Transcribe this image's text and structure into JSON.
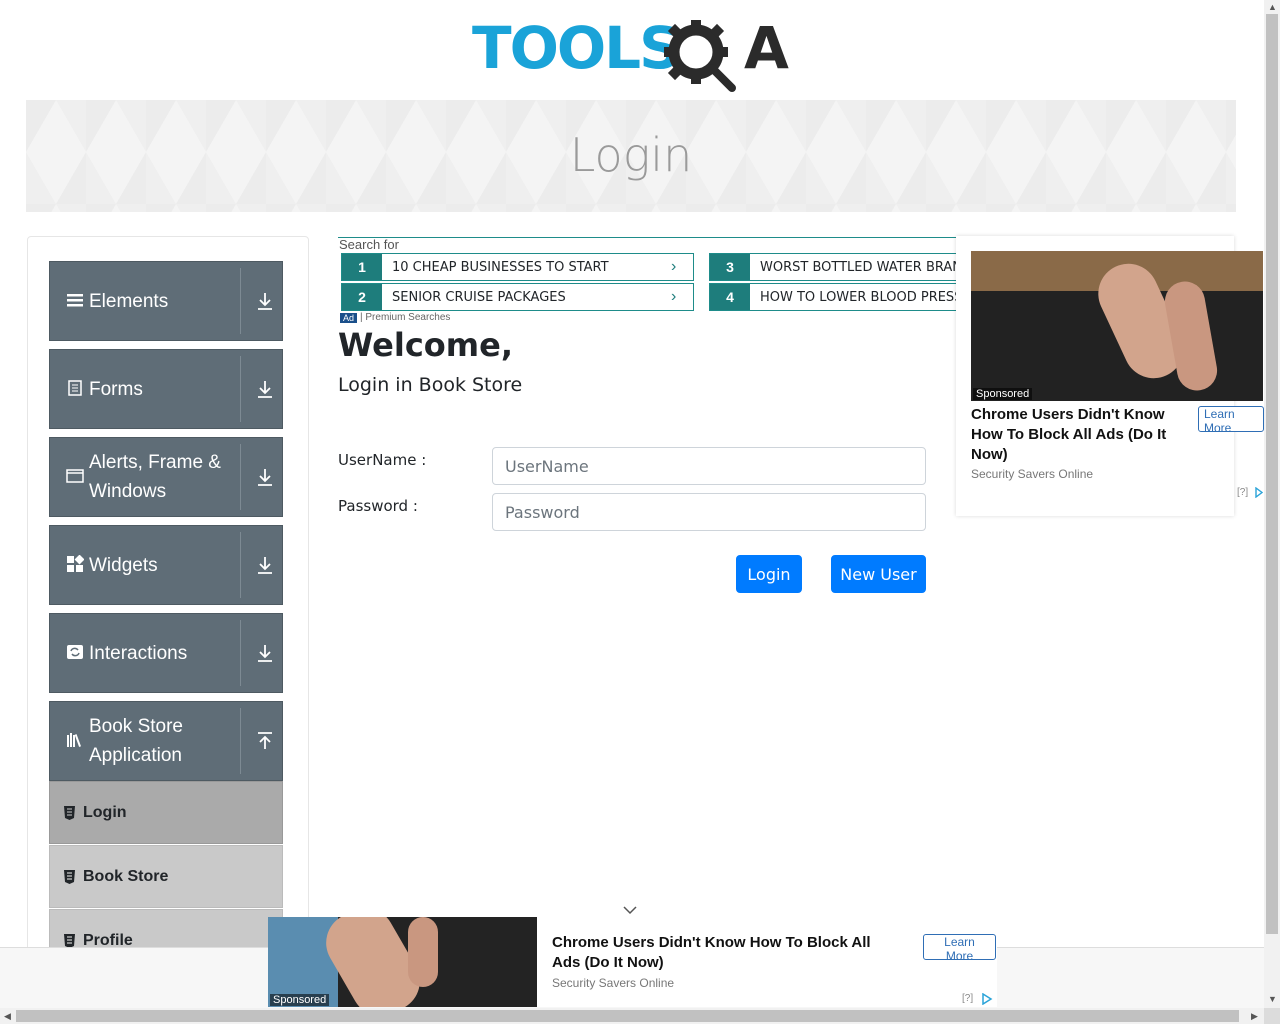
{
  "logo": {
    "text": "TOOLS",
    "text2": "A"
  },
  "banner": {
    "title": "Login"
  },
  "sidebar": {
    "groups": [
      {
        "label": "Elements",
        "icon": "menu-icon",
        "expanded": false
      },
      {
        "label": "Forms",
        "icon": "form-icon",
        "expanded": false
      },
      {
        "label": "Alerts, Frame & Windows",
        "icon": "window-icon",
        "expanded": false
      },
      {
        "label": "Widgets",
        "icon": "widgets-icon",
        "expanded": false
      },
      {
        "label": "Interactions",
        "icon": "interactions-icon",
        "expanded": false
      },
      {
        "label": "Book Store Application",
        "icon": "library-icon",
        "expanded": true
      }
    ],
    "subitems": [
      {
        "label": "Login",
        "active": true
      },
      {
        "label": "Book Store",
        "active": false
      },
      {
        "label": "Profile",
        "active": false
      }
    ]
  },
  "search_ad": {
    "caption": "Search for",
    "items": [
      {
        "num": "1",
        "text": "10 CHEAP BUSINESSES TO START"
      },
      {
        "num": "2",
        "text": "SENIOR CRUISE PACKAGES"
      },
      {
        "num": "3",
        "text": "WORST BOTTLED WATER BRANDS"
      },
      {
        "num": "4",
        "text": "HOW TO LOWER BLOOD PRESSURE"
      }
    ],
    "ad_badge": "Ad",
    "footer": "| Premium Searches"
  },
  "main": {
    "welcome": "Welcome,",
    "subtitle": "Login in Book Store",
    "username_label": "UserName :",
    "username_placeholder": "UserName",
    "username_value": "",
    "password_label": "Password :",
    "password_placeholder": "Password",
    "password_value": "",
    "login_button": "Login",
    "new_user_button": "New User"
  },
  "right_ad": {
    "sponsored": "Sponsored",
    "title": "Chrome Users Didn't Know How To Block All Ads (Do It Now)",
    "source": "Security Savers Online",
    "learn_more": "Learn More",
    "info": "[?]"
  },
  "bottom_ad": {
    "sponsored": "Sponsored",
    "title": "Chrome Users Didn't Know How To Block All Ads (Do It Now)",
    "source": "Security Savers Online",
    "learn_more": "Learn More",
    "info": "[?]"
  },
  "colors": {
    "brand_blue": "#1aa3d8",
    "sidebar_bg": "#5f6d77",
    "button_blue": "#007bff",
    "ad_teal": "#1e7d7c"
  }
}
